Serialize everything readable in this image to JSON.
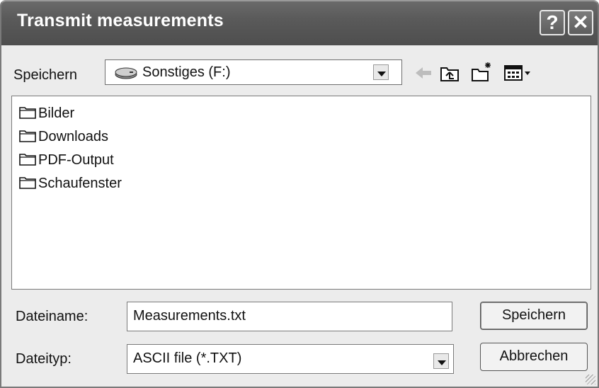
{
  "window": {
    "title": "Transmit measurements",
    "help_label": "?",
    "close_label": "✕"
  },
  "toolbar": {
    "lookin_label": "Speichern",
    "location": "Sonstiges (F:)",
    "icons": [
      "drive-icon",
      "back-icon",
      "up-folder-icon",
      "new-folder-icon",
      "view-menu-icon"
    ]
  },
  "files": [
    {
      "name": "Bilder"
    },
    {
      "name": "Downloads"
    },
    {
      "name": "PDF-Output"
    },
    {
      "name": "Schaufenster"
    }
  ],
  "filename": {
    "label": "Dateiname:",
    "value": "Measurements.txt"
  },
  "filetype": {
    "label": "Dateityp:",
    "value": "ASCII file (*.TXT)"
  },
  "buttons": {
    "save": "Speichern",
    "cancel": "Abbrechen"
  }
}
